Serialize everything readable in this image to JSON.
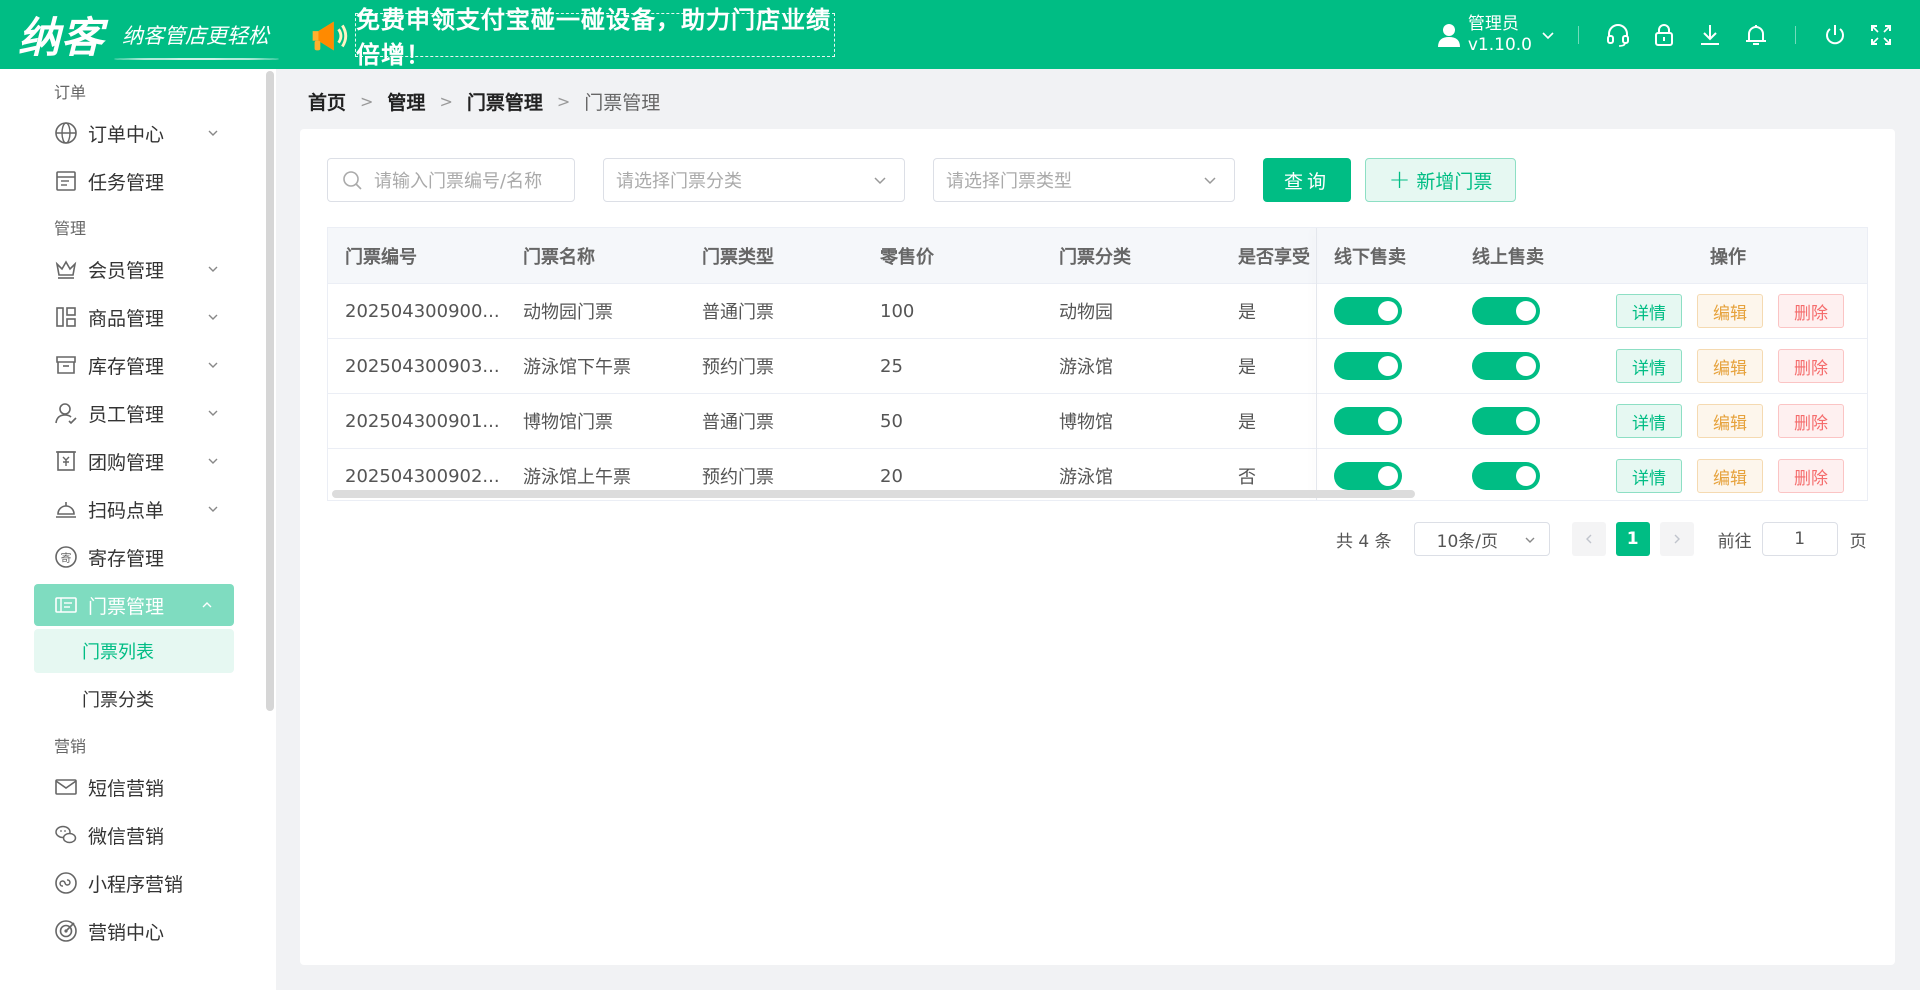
{
  "header": {
    "logo": "纳客",
    "slogan": "纳客管店更轻松",
    "promo": "免费申领支付宝碰一碰设备，助力门店业绩倍增！",
    "user_name": "管理员",
    "version": "v1.10.0",
    "bg_color": "#00bd84"
  },
  "sidebar": {
    "groups": [
      {
        "title": "订单",
        "items": [
          {
            "label": "订单中心",
            "icon": "globe-icon",
            "expandable": true
          },
          {
            "label": "任务管理",
            "icon": "task-icon",
            "expandable": false
          }
        ]
      },
      {
        "title": "管理",
        "items": [
          {
            "label": "会员管理",
            "icon": "crown-icon",
            "expandable": true
          },
          {
            "label": "商品管理",
            "icon": "goods-icon",
            "expandable": true
          },
          {
            "label": "库存管理",
            "icon": "box-icon",
            "expandable": true
          },
          {
            "label": "员工管理",
            "icon": "user-icon",
            "expandable": true
          },
          {
            "label": "团购管理",
            "icon": "groupbuy-icon",
            "expandable": true
          },
          {
            "label": "扫码点单",
            "icon": "bell-service-icon",
            "expandable": true
          },
          {
            "label": "寄存管理",
            "icon": "deposit-icon",
            "expandable": false
          },
          {
            "label": "门票管理",
            "icon": "ticket-icon",
            "expandable": true,
            "active": true
          }
        ]
      }
    ],
    "ticket_sub": [
      "门票列表",
      "门票分类"
    ],
    "marketing_title": "营销",
    "marketing_items": [
      {
        "label": "短信营销",
        "icon": "mail-icon"
      },
      {
        "label": "微信营销",
        "icon": "wechat-icon"
      },
      {
        "label": "小程序营销",
        "icon": "miniapp-icon"
      },
      {
        "label": "营销中心",
        "icon": "target-icon"
      }
    ]
  },
  "breadcrumb": [
    "首页",
    "管理",
    "门票管理",
    "门票管理"
  ],
  "filters": {
    "search_placeholder": "请输入门票编号/名称",
    "category_placeholder": "请选择门票分类",
    "type_placeholder": "请选择门票类型",
    "query_label": "查询",
    "add_label": "新增门票"
  },
  "table": {
    "columns": [
      "门票编号",
      "门票名称",
      "门票类型",
      "零售价",
      "门票分类",
      "是否享受",
      "线下售卖",
      "线上售卖",
      "操作"
    ],
    "rows": [
      {
        "code": "202504300900...",
        "name": "动物园门票",
        "type": "普通门票",
        "price": "100",
        "category": "动物园",
        "enjoy": "是",
        "offline": true,
        "online": true
      },
      {
        "code": "202504300903...",
        "name": "游泳馆下午票",
        "type": "预约门票",
        "price": "25",
        "category": "游泳馆",
        "enjoy": "是",
        "offline": true,
        "online": true
      },
      {
        "code": "202504300901...",
        "name": "博物馆门票",
        "type": "普通门票",
        "price": "50",
        "category": "博物馆",
        "enjoy": "是",
        "offline": true,
        "online": true
      },
      {
        "code": "202504300902...",
        "name": "游泳馆上午票",
        "type": "预约门票",
        "price": "20",
        "category": "游泳馆",
        "enjoy": "否",
        "offline": true,
        "online": true
      }
    ],
    "actions": {
      "detail": "详情",
      "edit": "编辑",
      "delete": "删除"
    }
  },
  "pagination": {
    "total": "共 4 条",
    "page_size": "10条/页",
    "current": "1",
    "goto_label": "前往",
    "goto_value": "1",
    "unit": "页"
  }
}
